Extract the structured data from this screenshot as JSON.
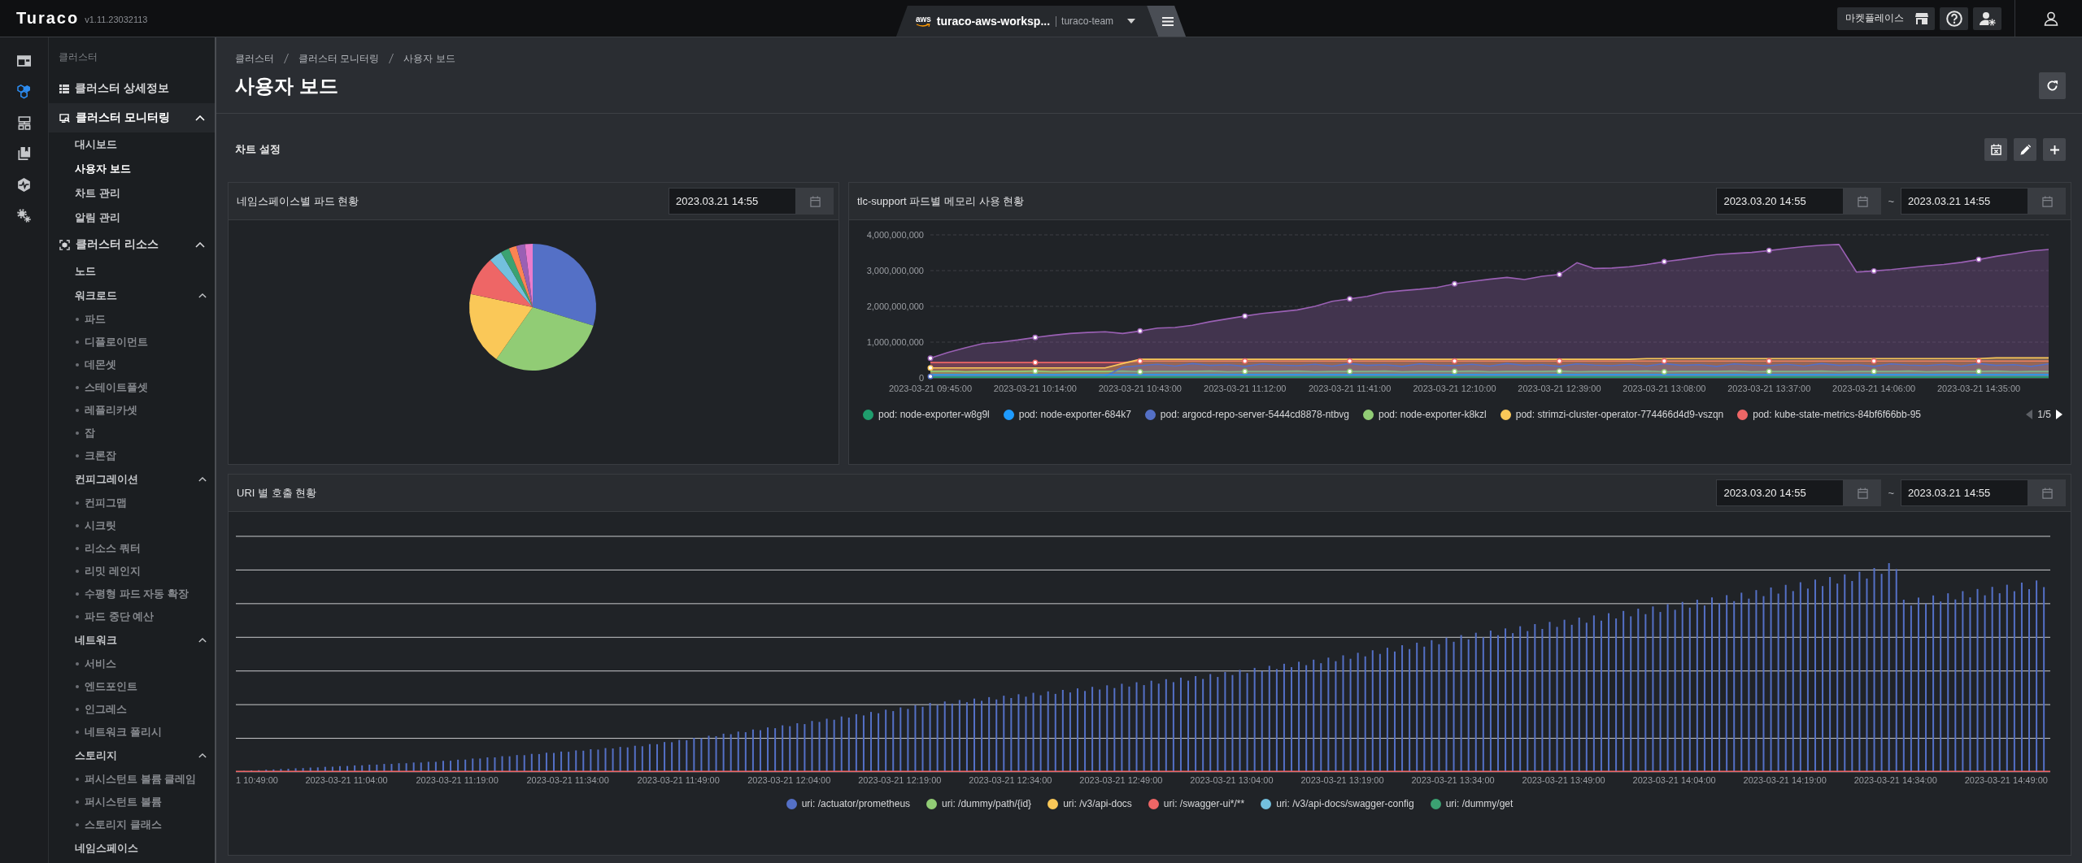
{
  "topbar": {
    "logo": "Turaco",
    "version": "v1.11.23032113",
    "workspace": {
      "provider": "aws",
      "name": "turaco-aws-worksp...",
      "team": "turaco-team"
    },
    "marketplace": "마켓플레이스"
  },
  "rail": [
    {
      "selected": false
    },
    {
      "selected": true
    },
    {
      "selected": false
    },
    {
      "selected": false
    },
    {
      "selected": false
    },
    {
      "selected": false
    }
  ],
  "sidebar": {
    "heading": "클러스터",
    "items": [
      {
        "kind": "link",
        "label": "클러스터 상세정보",
        "selected": false
      },
      {
        "kind": "group",
        "label": "클러스터 모니터링",
        "selected": true,
        "expanded": true,
        "children": [
          {
            "kind": "link",
            "label": "대시보드",
            "selected": false
          },
          {
            "kind": "link",
            "label": "사용자 보드",
            "selected": true
          },
          {
            "kind": "link",
            "label": "차트 관리",
            "selected": false
          },
          {
            "kind": "link",
            "label": "알림 관리",
            "selected": false
          }
        ]
      },
      {
        "kind": "group",
        "label": "클러스터 리소스",
        "selected": false,
        "expanded": true,
        "children": [
          {
            "kind": "link",
            "label": "노드",
            "selected": false
          },
          {
            "kind": "group",
            "label": "워크로드",
            "selected": false,
            "expanded": true,
            "children": [
              {
                "kind": "bullet",
                "label": "파드",
                "selected": false
              },
              {
                "kind": "bullet",
                "label": "디플로이먼트",
                "selected": false
              },
              {
                "kind": "bullet",
                "label": "데몬셋",
                "selected": false
              },
              {
                "kind": "bullet",
                "label": "스테이트풀셋",
                "selected": false
              },
              {
                "kind": "bullet",
                "label": "레플리카셋",
                "selected": false
              },
              {
                "kind": "bullet",
                "label": "잡",
                "selected": false
              },
              {
                "kind": "bullet",
                "label": "크론잡",
                "selected": false
              }
            ]
          },
          {
            "kind": "group",
            "label": "컨피그레이션",
            "selected": false,
            "expanded": true,
            "children": [
              {
                "kind": "bullet",
                "label": "컨피그맵",
                "selected": false
              },
              {
                "kind": "bullet",
                "label": "시크릿",
                "selected": false
              },
              {
                "kind": "bullet",
                "label": "리소스 쿼터",
                "selected": false
              },
              {
                "kind": "bullet",
                "label": "리밋 레인지",
                "selected": false
              },
              {
                "kind": "bullet",
                "label": "수평형 파드 자동 확장",
                "selected": false
              },
              {
                "kind": "bullet",
                "label": "파드 중단 예산",
                "selected": false
              }
            ]
          },
          {
            "kind": "group",
            "label": "네트워크",
            "selected": false,
            "expanded": true,
            "children": [
              {
                "kind": "bullet",
                "label": "서비스",
                "selected": false
              },
              {
                "kind": "bullet",
                "label": "엔드포인트",
                "selected": false
              },
              {
                "kind": "bullet",
                "label": "인그레스",
                "selected": false
              },
              {
                "kind": "bullet",
                "label": "네트워크 폴리시",
                "selected": false
              }
            ]
          },
          {
            "kind": "group",
            "label": "스토리지",
            "selected": false,
            "expanded": true,
            "children": [
              {
                "kind": "bullet",
                "label": "퍼시스턴트 볼륨 클레임",
                "selected": false
              },
              {
                "kind": "bullet",
                "label": "퍼시스턴트 볼륨",
                "selected": false
              },
              {
                "kind": "bullet",
                "label": "스토리지 클래스",
                "selected": false
              }
            ]
          },
          {
            "kind": "link",
            "label": "네임스페이스",
            "selected": false
          }
        ]
      }
    ]
  },
  "main": {
    "breadcrumb": [
      "클러스터",
      "클러스터 모니터링",
      "사용자 보드"
    ],
    "title": "사용자 보드",
    "section_title": "차트 설정",
    "panels": [
      {
        "kind": "pie",
        "title": "네임스페이스별 파드 현황",
        "dates": [
          "2023.03.21 14:55"
        ]
      },
      {
        "kind": "line",
        "title": "tlc-support 파드별 메모리 사용 현황",
        "dates": [
          "2023.03.20 14:55",
          "2023.03.21 14:55"
        ],
        "range_separator": "~",
        "chart_data": {
          "type": "area",
          "categories": [
            "2023-03-21 09:45:00",
            null,
            null,
            null,
            null,
            null,
            "2023-03-21 10:14:00",
            null,
            null,
            null,
            null,
            null,
            "2023-03-21 10:43:00",
            null,
            null,
            null,
            null,
            null,
            "2023-03-21 11:12:00",
            null,
            null,
            null,
            null,
            null,
            "2023-03-21 11:41:00",
            null,
            null,
            null,
            null,
            null,
            "2023-03-21 12:10:00",
            null,
            null,
            null,
            null,
            null,
            "2023-03-21 12:39:00",
            null,
            null,
            null,
            null,
            null,
            "2023-03-21 13:08:00",
            null,
            null,
            null,
            null,
            null,
            "2023-03-21 13:37:00",
            null,
            null,
            null,
            null,
            null,
            "2023-03-21 14:06:00",
            null,
            null,
            null,
            null,
            null,
            "2023-03-21 14:35:00",
            null,
            null,
            null,
            null
          ],
          "ylim": [
            0,
            4000000000
          ],
          "yticks": [
            {
              "value": 0,
              "label": "0"
            },
            {
              "value": 1000000000,
              "label": "1,000,000,000"
            },
            {
              "value": 2000000000,
              "label": "2,000,000,000"
            },
            {
              "value": 3000000000,
              "label": "3,000,000,000"
            },
            {
              "value": 4000000000,
              "label": "4,000,000,000"
            }
          ],
          "grid": true,
          "legend": "bottom",
          "series": [
            {
              "name": "pod: node-exporter-w8g9l",
              "color": "#1f9d6d",
              "values": [
                20000000,
                20000000,
                20000000,
                20000000,
                20000000,
                20000000,
                20000000,
                20000000,
                20000000,
                20000000,
                20000000,
                20000000,
                20000000,
                20000000,
                20000000,
                20000000,
                20000000,
                20000000,
                20000000,
                20000000,
                20000000,
                20000000,
                20000000,
                20000000,
                20000000,
                20000000,
                20000000,
                20000000,
                20000000,
                20000000,
                20000000,
                20000000,
                20000000,
                20000000,
                20000000,
                20000000,
                20000000,
                20000000,
                20000000,
                20000000,
                20000000,
                20000000,
                20000000,
                20000000,
                20000000,
                20000000,
                20000000,
                20000000,
                20000000,
                20000000,
                20000000,
                20000000,
                20000000,
                20000000,
                20000000,
                20000000,
                20000000,
                20000000,
                20000000,
                20000000,
                20000000,
                20000000,
                20000000,
                20000000,
                20000000
              ]
            },
            {
              "name": "pod: node-exporter-684k7",
              "color": "#1e9bff",
              "values": [
                90000000,
                90000000,
                90000000,
                90000000,
                90000000,
                90000000,
                90000000,
                90000000,
                90000000,
                90000000,
                90000000,
                90000000,
                90000000,
                90000000,
                90000000,
                90000000,
                90000000,
                90000000,
                90000000,
                90000000,
                90000000,
                90000000,
                90000000,
                90000000,
                90000000,
                90000000,
                90000000,
                90000000,
                90000000,
                90000000,
                90000000,
                90000000,
                90000000,
                90000000,
                90000000,
                90000000,
                90000000,
                90000000,
                90000000,
                90000000,
                90000000,
                90000000,
                90000000,
                90000000,
                90000000,
                90000000,
                90000000,
                90000000,
                90000000,
                90000000,
                90000000,
                90000000,
                90000000,
                90000000,
                90000000,
                90000000,
                90000000,
                90000000,
                90000000,
                90000000,
                90000000,
                90000000,
                90000000,
                90000000,
                90000000
              ]
            },
            {
              "name": "pod: argocd-repo-server-5444cd8878-ntbvg",
              "color": "#5470c6",
              "values": [
                40000000,
                40000000,
                40000000,
                40000000,
                40000000,
                40000000,
                40000000,
                40000000,
                40000000,
                40000000,
                40000000,
                300000000,
                340000000,
                380000000,
                330000000,
                400000000,
                350000000,
                370000000,
                320000000,
                390000000,
                360000000,
                340000000,
                380000000,
                330000000,
                400000000,
                350000000,
                370000000,
                320000000,
                390000000,
                360000000,
                340000000,
                380000000,
                330000000,
                400000000,
                350000000,
                370000000,
                320000000,
                390000000,
                360000000,
                340000000,
                380000000,
                330000000,
                400000000,
                350000000,
                370000000,
                320000000,
                390000000,
                360000000,
                340000000,
                380000000,
                330000000,
                400000000,
                350000000,
                370000000,
                320000000,
                390000000,
                360000000,
                340000000,
                380000000,
                330000000,
                400000000,
                350000000,
                370000000,
                320000000,
                390000000
              ]
            },
            {
              "name": "pod: node-exporter-k8kzl",
              "color": "#91cc75",
              "values": [
                180000000,
                190000000,
                170000000,
                180000000,
                180000000,
                180000000,
                190000000,
                170000000,
                180000000,
                180000000,
                180000000,
                190000000,
                170000000,
                180000000,
                180000000,
                180000000,
                190000000,
                170000000,
                180000000,
                180000000,
                180000000,
                190000000,
                170000000,
                180000000,
                180000000,
                180000000,
                190000000,
                170000000,
                180000000,
                180000000,
                180000000,
                190000000,
                170000000,
                180000000,
                180000000,
                180000000,
                190000000,
                170000000,
                180000000,
                180000000,
                180000000,
                190000000,
                170000000,
                180000000,
                180000000,
                180000000,
                190000000,
                170000000,
                180000000,
                180000000,
                180000000,
                190000000,
                170000000,
                180000000,
                180000000,
                180000000,
                190000000,
                170000000,
                180000000,
                180000000,
                180000000,
                190000000,
                170000000,
                180000000,
                180000000
              ]
            },
            {
              "name": "pod: strimzi-cluster-operator-774466d4d9-vszqn",
              "color": "#fac858",
              "values": [
                280000000,
                280000000,
                280000000,
                280000000,
                280000000,
                280000000,
                280000000,
                280000000,
                280000000,
                280000000,
                280000000,
                400000000,
                520000000,
                520000000,
                520000000,
                520000000,
                520000000,
                520000000,
                520000000,
                520000000,
                520000000,
                520000000,
                520000000,
                520000000,
                520000000,
                520000000,
                520000000,
                520000000,
                520000000,
                520000000,
                520000000,
                520000000,
                520000000,
                520000000,
                520000000,
                520000000,
                520000000,
                520000000,
                520000000,
                520000000,
                520000000,
                540000000,
                540000000,
                540000000,
                540000000,
                540000000,
                540000000,
                540000000,
                540000000,
                540000000,
                540000000,
                540000000,
                540000000,
                540000000,
                540000000,
                540000000,
                540000000,
                540000000,
                540000000,
                540000000,
                540000000,
                560000000,
                560000000,
                560000000,
                560000000
              ]
            },
            {
              "name": "pod: kube-state-metrics-84bf6f66bb-95",
              "color": "#ee6666",
              "values": [
                430000000,
                430000000,
                430000000,
                430000000,
                430000000,
                430000000,
                430000000,
                430000000,
                430000000,
                430000000,
                430000000,
                430000000,
                470000000,
                470000000,
                470000000,
                470000000,
                470000000,
                470000000,
                470000000,
                470000000,
                470000000,
                470000000,
                470000000,
                470000000,
                470000000,
                470000000,
                470000000,
                470000000,
                470000000,
                470000000,
                470000000,
                470000000,
                470000000,
                470000000,
                470000000,
                470000000,
                470000000,
                470000000,
                470000000,
                470000000,
                470000000,
                470000000,
                470000000,
                470000000,
                470000000,
                470000000,
                470000000,
                470000000,
                470000000,
                470000000,
                470000000,
                470000000,
                470000000,
                470000000,
                470000000,
                470000000,
                470000000,
                470000000,
                470000000,
                470000000,
                470000000,
                470000000,
                470000000,
                470000000,
                470000000
              ]
            },
            {
              "color": "#9a60b4",
              "values": [
                550000000,
                710000000,
                840000000,
                960000000,
                1000000000,
                1060000000,
                1130000000,
                1190000000,
                1240000000,
                1270000000,
                1290000000,
                1240000000,
                1310000000,
                1390000000,
                1410000000,
                1470000000,
                1570000000,
                1650000000,
                1730000000,
                1800000000,
                1850000000,
                1900000000,
                2000000000,
                2140000000,
                2210000000,
                2280000000,
                2390000000,
                2440000000,
                2480000000,
                2530000000,
                2630000000,
                2700000000,
                2760000000,
                2810000000,
                2750000000,
                2840000000,
                2890000000,
                3220000000,
                3060000000,
                3070000000,
                3110000000,
                3170000000,
                3250000000,
                3310000000,
                3380000000,
                3450000000,
                3480000000,
                3510000000,
                3560000000,
                3620000000,
                3670000000,
                3710000000,
                3730000000,
                2960000000,
                2990000000,
                3030000000,
                3080000000,
                3130000000,
                3170000000,
                3230000000,
                3310000000,
                3400000000,
                3470000000,
                3550000000,
                3590000000
              ]
            }
          ]
        },
        "legend_pager": {
          "label": "1/5",
          "prev_disabled": true,
          "next_disabled": false
        }
      },
      {
        "kind": "bar",
        "title": "URI 별 호출 현황",
        "dates": [
          "2023.03.20 14:55",
          "2023.03.21 14:55"
        ],
        "range_separator": "~",
        "x_labels": [
          "1 10:49:00",
          "2023-03-21 11:04:00",
          "2023-03-21 11:19:00",
          "2023-03-21 11:34:00",
          "2023-03-21 11:49:00",
          "2023-03-21 12:04:00",
          "2023-03-21 12:19:00",
          "2023-03-21 12:34:00",
          "2023-03-21 12:49:00",
          "2023-03-21 13:04:00",
          "2023-03-21 13:19:00",
          "2023-03-21 13:34:00",
          "2023-03-21 13:49:00",
          "2023-03-21 14:04:00",
          "2023-03-21 14:19:00",
          "2023-03-21 14:34:00",
          "2023-03-21 14:49:00"
        ],
        "legend": [
          {
            "name": "uri: /actuator/prometheus",
            "color": "#5470c6"
          },
          {
            "name": "uri: /dummy/path/{id}",
            "color": "#91cc75"
          },
          {
            "name": "uri: /v3/api-docs",
            "color": "#fac858"
          },
          {
            "name": "uri: /swagger-ui*/**",
            "color": "#ee6666"
          },
          {
            "name": "uri: /v3/api-docs/swagger-config",
            "color": "#73c0de"
          },
          {
            "name": "uri: /dummy/get",
            "color": "#3ba272"
          }
        ]
      }
    ]
  }
}
